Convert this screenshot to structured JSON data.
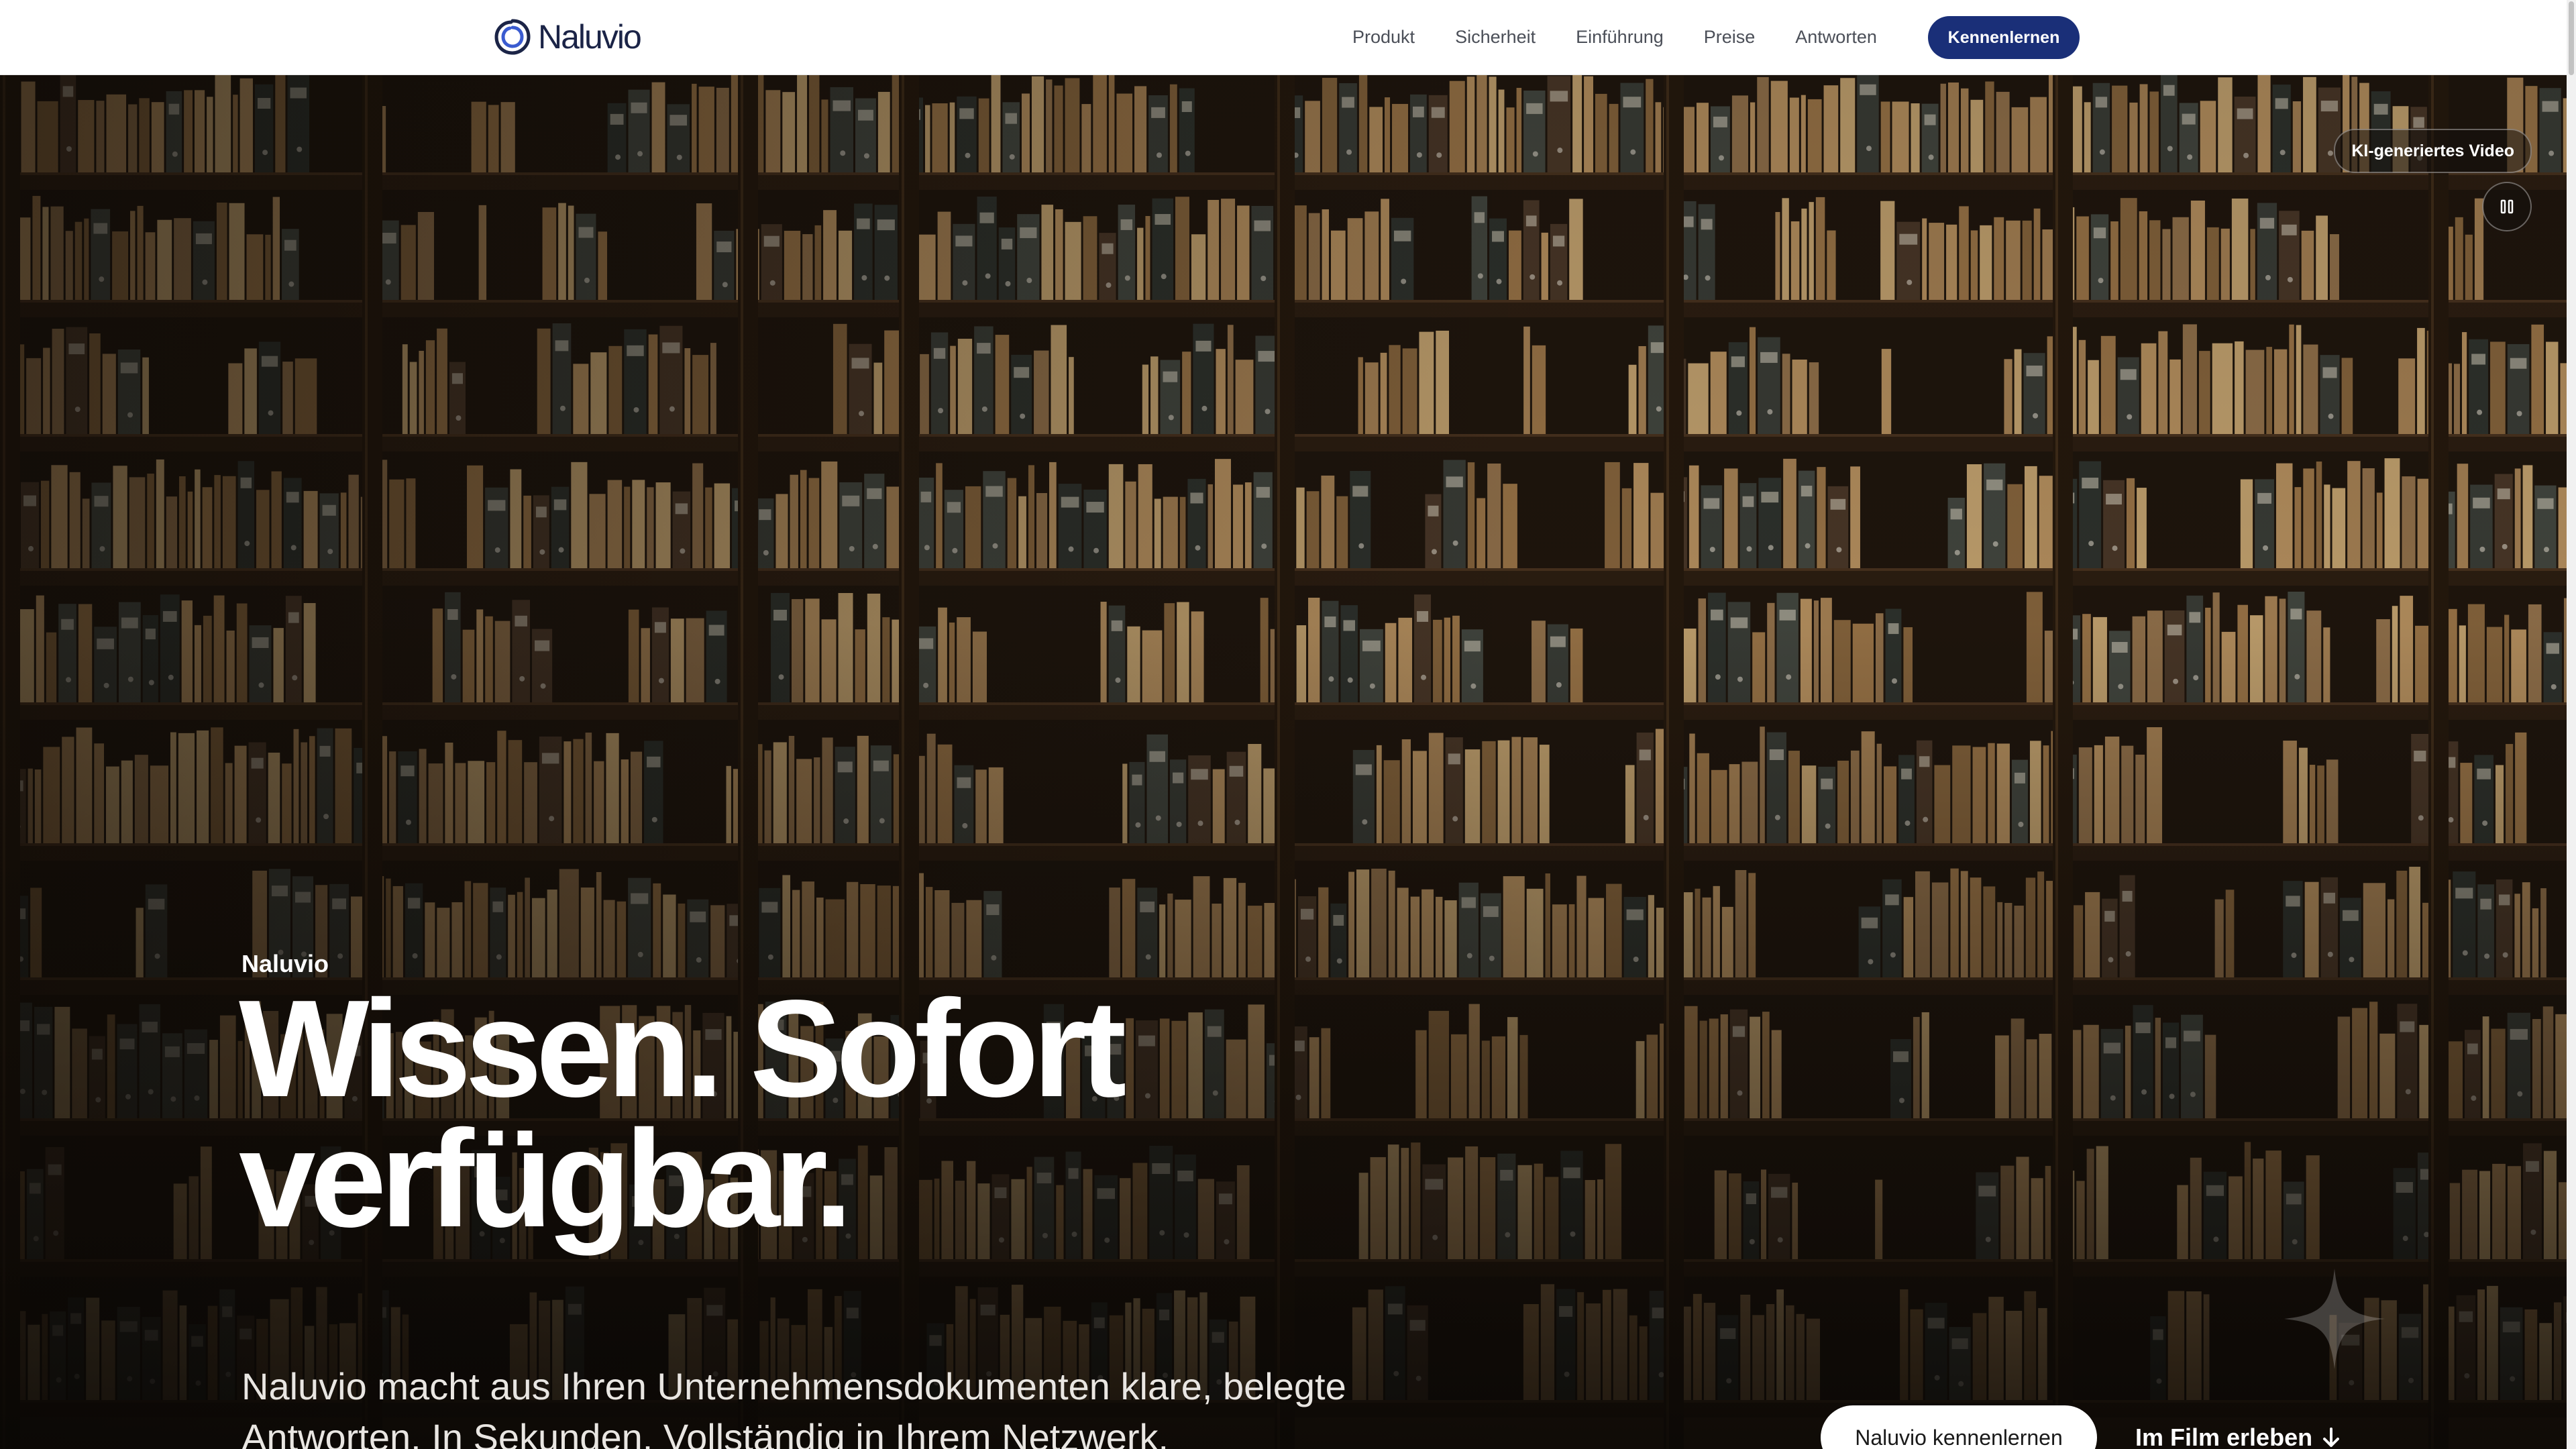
{
  "brand": {
    "name": "Naluvio",
    "color": "#1b2447"
  },
  "nav": {
    "items": [
      "Produkt",
      "Sicherheit",
      "Einführung",
      "Preise",
      "Antworten"
    ],
    "cta_label": "Kennenlernen",
    "cta_color": "#1a2f78"
  },
  "video": {
    "badge": "KI-generiertes Video",
    "pause_icon": "pause-icon"
  },
  "hero": {
    "eyebrow": "Naluvio",
    "headline_line1": "Wissen. Sofort",
    "headline_line2": "verfügbar.",
    "subline_line1": "Naluvio macht aus Ihren Unternehmensdokumenten klare, belegte",
    "subline_line2": "Antworten. In Sekunden. Vollständig in Ihrem Netzwerk.",
    "primary_cta": "Naluvio kennenlernen",
    "secondary_cta": "Im Film erleben",
    "secondary_icon": "arrow-down-icon"
  }
}
